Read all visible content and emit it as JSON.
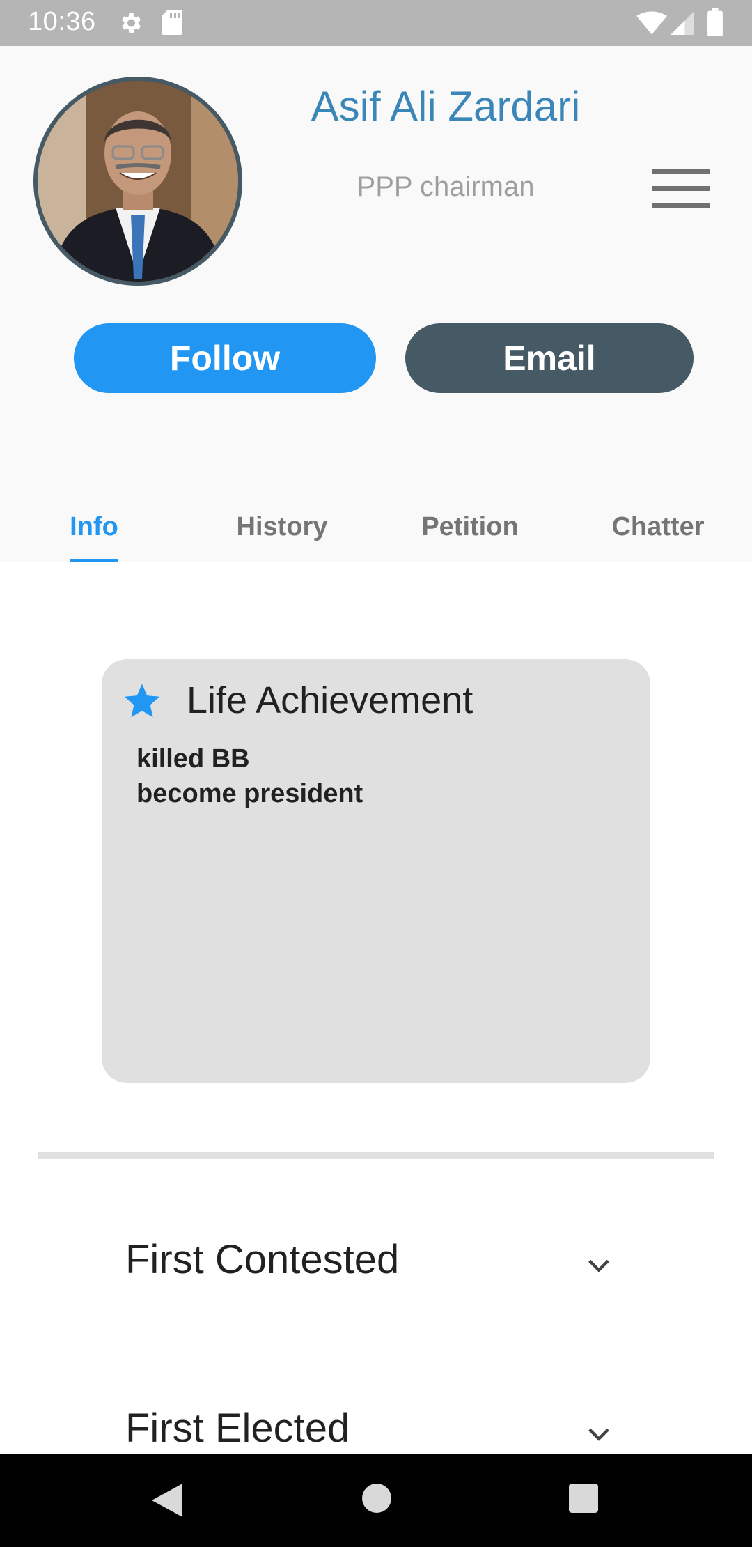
{
  "status_bar": {
    "time": "10:36",
    "icons": [
      "gear-icon",
      "sd-card-icon",
      "wifi-icon",
      "cell-signal-icon",
      "battery-icon"
    ]
  },
  "profile": {
    "name": "Asif Ali Zardari",
    "subtitle": "PPP chairman",
    "avatar_icon": "profile-photo"
  },
  "actions": {
    "follow_label": "Follow",
    "email_label": "Email"
  },
  "tabs": [
    {
      "label": "Info",
      "active": true
    },
    {
      "label": "History",
      "active": false
    },
    {
      "label": "Petition",
      "active": false
    },
    {
      "label": "Chatter",
      "active": false
    }
  ],
  "achievement": {
    "title": "Life Achievement",
    "icon": "star-icon",
    "lines": [
      "killed BB",
      "become president"
    ]
  },
  "expanders": [
    {
      "label": "First Contested",
      "icon": "chevron-down-icon"
    },
    {
      "label": "First Elected",
      "icon": "chevron-down-icon"
    }
  ],
  "colors": {
    "accent": "#2196f3",
    "name_text": "#3a86b8",
    "email_button": "#455a64",
    "card_background": "#e0e0e0",
    "status_bar": "#b5b5b5"
  }
}
